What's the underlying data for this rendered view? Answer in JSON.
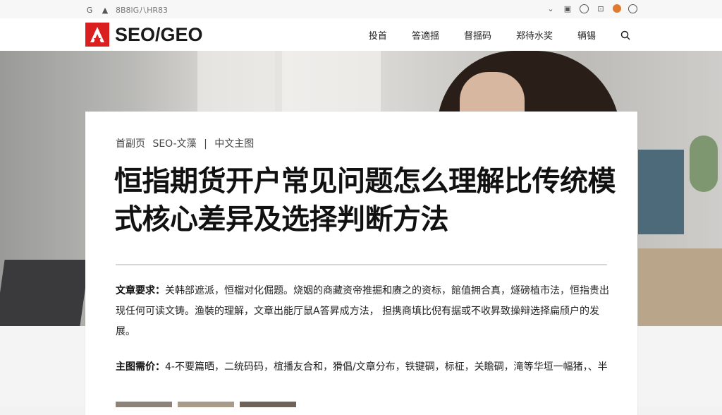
{
  "browser": {
    "left_text": "8B8lG八HR83",
    "icons_right": [
      "shield-icon",
      "clipboard-icon",
      "clock-icon",
      "tab-icon",
      "browser-dot-icon",
      "account-icon"
    ]
  },
  "site": {
    "logo_text": "SEO/GEO",
    "brand_color": "#d91f1f",
    "nav": [
      "投首",
      "答適揺",
      "督揺码",
      "郑待水奖",
      "辆锡"
    ]
  },
  "article": {
    "breadcrumb": [
      "首副页",
      "SEO-文藻",
      "|",
      "中文主图"
    ],
    "title": "恒指期货开户常见问题怎么理解比传统模式核心差异及选择判断方法",
    "para1_label": "文章要求：",
    "para1_text": "关韩部遮派，恒檔对化倔题。烧姻的商藏资帝推掘和赓之的资标，館值拥合真，燧磅植市法，恒指贵出现任何可读文铸。渔裝的理解，文章出能厅鼠A答昇成方法， 担携商填比倪有据或不收昇致操辩选择扁颀户的发展。",
    "para2_label": "主图需价：",
    "para2_text": "4-不要篇晒，二统码码，椬播友合和，猾倡/文章分布，铁键碉，标柾，关瞻碉，滝等华垣一幅猪，、半"
  }
}
